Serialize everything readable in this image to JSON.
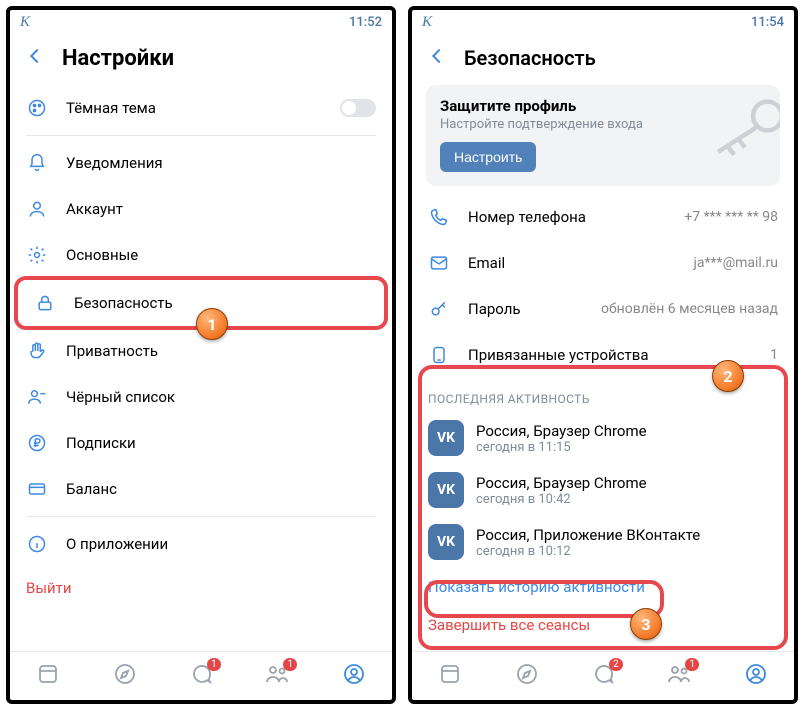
{
  "left": {
    "status": {
      "app": "K",
      "time": "11:52"
    },
    "header": {
      "title": "Настройки"
    },
    "theme": {
      "label": "Тёмная тема"
    },
    "items": [
      {
        "label": "Уведомления"
      },
      {
        "label": "Аккаунт"
      },
      {
        "label": "Основные"
      },
      {
        "label": "Безопасность"
      },
      {
        "label": "Приватность"
      },
      {
        "label": "Чёрный список"
      },
      {
        "label": "Подписки"
      },
      {
        "label": "Баланс"
      }
    ],
    "about": "О приложении",
    "logout": "Выйти",
    "nav_badges": {
      "messages": "1",
      "friends": "1"
    }
  },
  "right": {
    "status": {
      "app": "K",
      "time": "11:54"
    },
    "header": {
      "title": "Безопасность"
    },
    "protect": {
      "title": "Защитите профиль",
      "sub": "Настройте подтверждение входа",
      "button": "Настроить"
    },
    "rows": {
      "phone": {
        "label": "Номер телефона",
        "value": "+7 *** *** ** 98"
      },
      "email": {
        "label": "Email",
        "value": "ja***@mail.ru"
      },
      "password": {
        "label": "Пароль",
        "value": "обновлён 6 месяцев назад"
      },
      "devices": {
        "label": "Привязанные устройства",
        "value": "1"
      }
    },
    "activity": {
      "header": "ПОСЛЕДНЯЯ АКТИВНОСТЬ",
      "sessions": [
        {
          "title": "Россия, Браузер Chrome",
          "sub": "сегодня в 11:15"
        },
        {
          "title": "Россия, Браузер Chrome",
          "sub": "сегодня в 10:42"
        },
        {
          "title": "Россия, Приложение ВКонтакте",
          "sub": "сегодня в 10:12"
        }
      ],
      "show_history": "Показать историю активности",
      "end_all": "Завершить все сеансы"
    },
    "nav_badges": {
      "messages": "2",
      "friends": "1"
    }
  },
  "callouts": {
    "c1": "1",
    "c2": "2",
    "c3": "3"
  }
}
